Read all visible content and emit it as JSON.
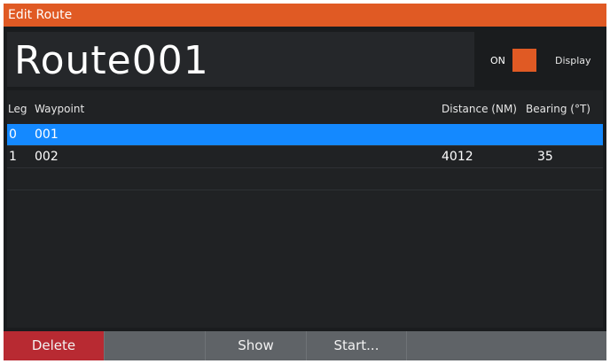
{
  "window": {
    "title": "Edit Route"
  },
  "route": {
    "name": "Route001",
    "toggle_label": "ON",
    "display_label": "Display"
  },
  "table": {
    "headers": {
      "leg": "Leg",
      "waypoint": "Waypoint",
      "distance": "Distance (NM)",
      "bearing": "Bearing (°T)"
    },
    "rows": [
      {
        "leg": "0",
        "waypoint": "001",
        "distance": "",
        "bearing": "",
        "selected": true
      },
      {
        "leg": "1",
        "waypoint": "002",
        "distance": "4012",
        "bearing": "35",
        "selected": false
      }
    ]
  },
  "softkeys": {
    "delete": "Delete",
    "show": "Show",
    "start": "Start..."
  },
  "colors": {
    "accent": "#e05a24",
    "selection": "#1489ff",
    "delete": "#b82a32",
    "background": "#1a1c1e"
  }
}
